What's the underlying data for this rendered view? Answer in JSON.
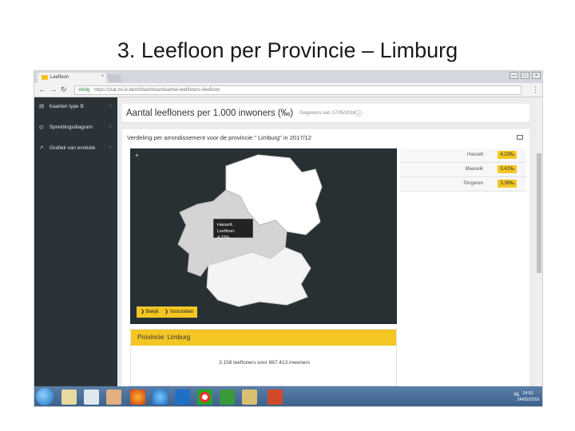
{
  "slide": {
    "title": "3. Leefloon per Provincie – Limburg"
  },
  "browser": {
    "tab_label": "Leefloon",
    "tab_close": "×",
    "window_buttons": [
      "—",
      "□",
      "×"
    ],
    "nav": {
      "back": "←",
      "forward": "→",
      "reload": "↻"
    },
    "url_secure_label": "Veilig",
    "url": "https://stat.mi-is.be/nl/dashboard/aantal-leefloners-/leefloon",
    "menu": "⋮"
  },
  "sidebar": {
    "items": [
      {
        "icon": "▤",
        "label": "Kaarten type B",
        "chevron": "›"
      },
      {
        "icon": "◎",
        "label": "Spreidingsdiagram",
        "chevron": "›"
      },
      {
        "icon": "↗",
        "label": "Grafiek van evolutie",
        "chevron": "›"
      }
    ]
  },
  "page": {
    "title": "Aantal leefloners per 1.000 inwoners (‰)",
    "date": "Gegevens van 17/05/2018",
    "info_icon": "ⓘ"
  },
  "panel": {
    "title": "Verdeling per arrondissement voor de provincie \" Limburg\" in 2017/12",
    "zoom": "+",
    "tooltip": {
      "line1": "Hasselt,",
      "line2": "Leefloon: 4,23‰"
    },
    "buttons": [
      {
        "label": "❯ Bekijk"
      },
      {
        "label": "❯ Voorstellen"
      }
    ],
    "table": [
      {
        "name": "Hasselt",
        "value": "4,23‰"
      },
      {
        "name": "Maaseik",
        "value": "3,41‰"
      },
      {
        "name": "Tongeren",
        "value": "3,36‰"
      }
    ]
  },
  "province": {
    "header": "Provincie: Limburg",
    "summary": "3.158 leefloners voor 867.413 inwoners"
  },
  "taskbar": {
    "tray": "NL",
    "time": "14:51",
    "date": "24/05/2018"
  },
  "colors": {
    "accent": "#f3c623",
    "sidebar": "#2c3338",
    "map_bg": "#283034"
  }
}
